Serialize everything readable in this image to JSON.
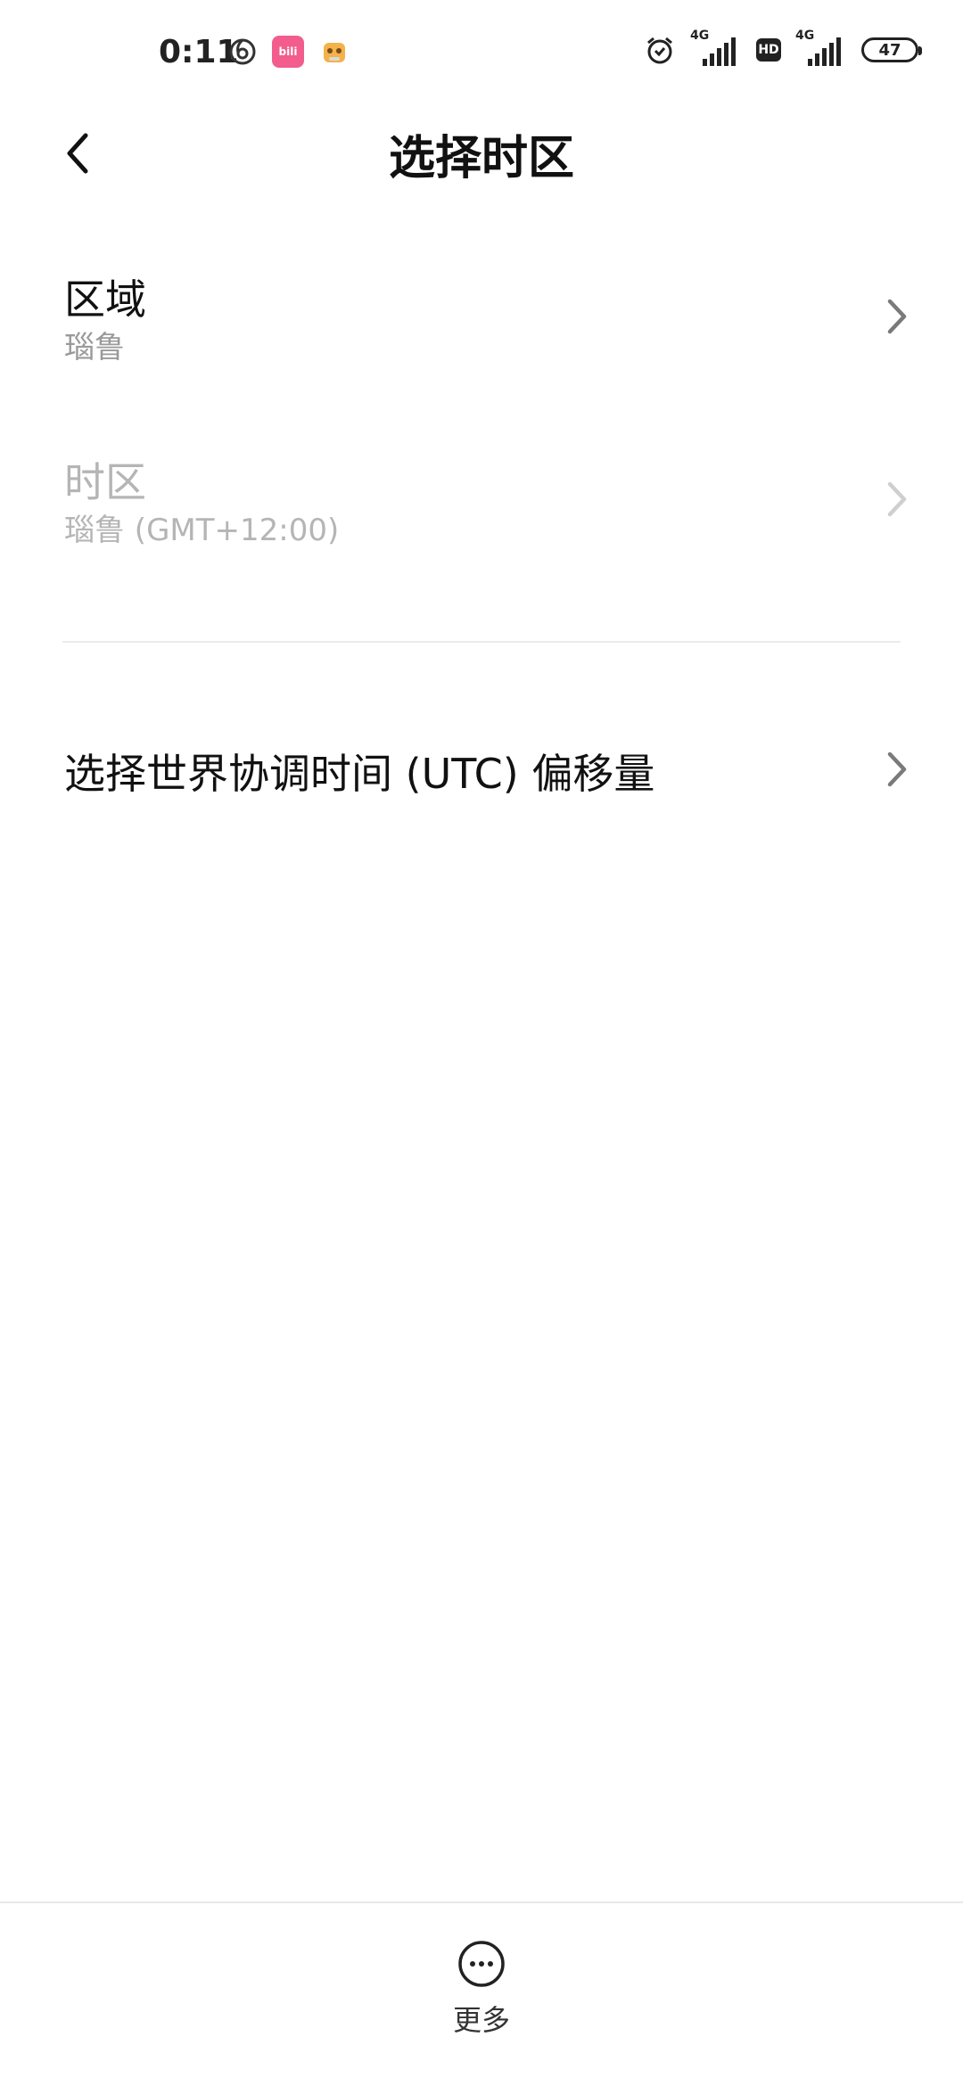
{
  "status_bar": {
    "time": "0:11",
    "bili_label": "bili",
    "signal1_label": "4G",
    "hd_label": "HD",
    "signal2_label": "4G",
    "battery_level": "47"
  },
  "header": {
    "title": "选择时区"
  },
  "rows": {
    "region": {
      "title": "区域",
      "subtitle": "瑙鲁"
    },
    "timezone": {
      "title": "时区",
      "subtitle": "瑙鲁 (GMT+12:00)"
    },
    "utc_offset": {
      "title": "选择世界协调时间 (UTC) 偏移量"
    }
  },
  "bottom_bar": {
    "more_label": "更多"
  },
  "colors": {
    "text_primary": "#111111",
    "text_secondary": "#9a9a9a",
    "text_disabled": "#b5b5b5",
    "chevron": "#7a7a7a",
    "chevron_disabled": "#cfcfcf",
    "bili_pink": "#f25d8e"
  }
}
